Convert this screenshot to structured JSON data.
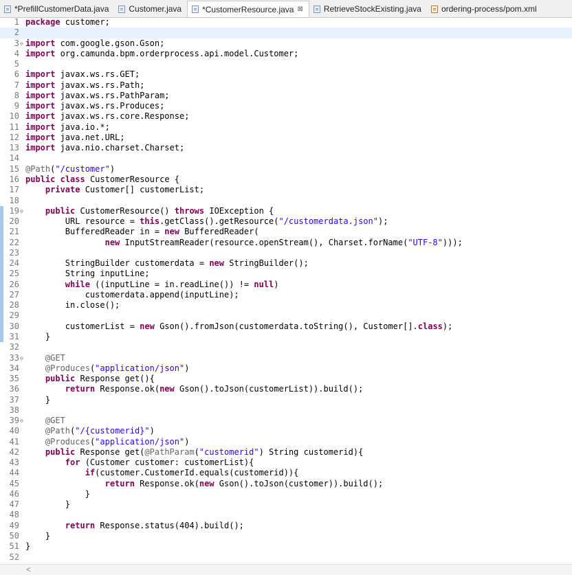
{
  "tabs": [
    {
      "label": "*PrefillCustomerData.java",
      "icon": "java-file-icon",
      "active": false
    },
    {
      "label": "Customer.java",
      "icon": "java-file-icon",
      "active": false
    },
    {
      "label": "*CustomerResource.java",
      "icon": "java-file-icon",
      "active": true,
      "close": "⊠"
    },
    {
      "label": "RetrieveStockExisting.java",
      "icon": "java-file-icon",
      "active": false
    },
    {
      "label": "ordering-process/pom.xml",
      "icon": "xml-file-icon",
      "active": false
    }
  ],
  "editor": {
    "current_line": 2,
    "fold_marker": "⊖",
    "folded_lines": [
      3,
      19,
      33,
      39
    ],
    "changed_lines": [
      19,
      20,
      21,
      22,
      23,
      24,
      25,
      26,
      27,
      28,
      29,
      30,
      31
    ],
    "keywords": [
      "package",
      "import",
      "public",
      "class",
      "private",
      "throws",
      "this",
      "new",
      "while",
      "null",
      "return",
      "for",
      "if"
    ],
    "colors": {
      "keyword": "#7f0055",
      "string": "#2a00ff",
      "annotation": "#646464",
      "line_number": "#787878",
      "current_line_bg": "#e8f2fe",
      "change_bar": "#a9c7e8"
    },
    "lines": [
      "package customer;",
      "",
      "import com.google.gson.Gson;",
      "import org.camunda.bpm.orderprocess.api.model.Customer;",
      "",
      "import javax.ws.rs.GET;",
      "import javax.ws.rs.Path;",
      "import javax.ws.rs.PathParam;",
      "import javax.ws.rs.Produces;",
      "import javax.ws.rs.core.Response;",
      "import java.io.*;",
      "import java.net.URL;",
      "import java.nio.charset.Charset;",
      "",
      "@Path(\"/customer\")",
      "public class CustomerResource {",
      "    private Customer[] customerList;",
      "",
      "    public CustomerResource() throws IOException {",
      "        URL resource = this.getClass().getResource(\"/customerdata.json\");",
      "        BufferedReader in = new BufferedReader(",
      "                new InputStreamReader(resource.openStream(), Charset.forName(\"UTF-8\")));",
      "",
      "        StringBuilder customerdata = new StringBuilder();",
      "        String inputLine;",
      "        while ((inputLine = in.readLine()) != null)",
      "            customerdata.append(inputLine);",
      "        in.close();",
      "",
      "        customerList = new Gson().fromJson(customerdata.toString(), Customer[].class);",
      "    }",
      "",
      "    @GET",
      "    @Produces(\"application/json\")",
      "    public Response get(){",
      "        return Response.ok(new Gson().toJson(customerList)).build();",
      "    }",
      "",
      "    @GET",
      "    @Path(\"/{customerid}\")",
      "    @Produces(\"application/json\")",
      "    public Response get(@PathParam(\"customerid\") String customerid){",
      "        for (Customer customer: customerList){",
      "            if(customer.CustomerId.equals(customerid)){",
      "                return Response.ok(new Gson().toJson(customer)).build();",
      "            }",
      "        }",
      "",
      "        return Response.status(404).build();",
      "    }",
      "}",
      ""
    ]
  },
  "scrollbar": {
    "left_arrow": "<"
  }
}
